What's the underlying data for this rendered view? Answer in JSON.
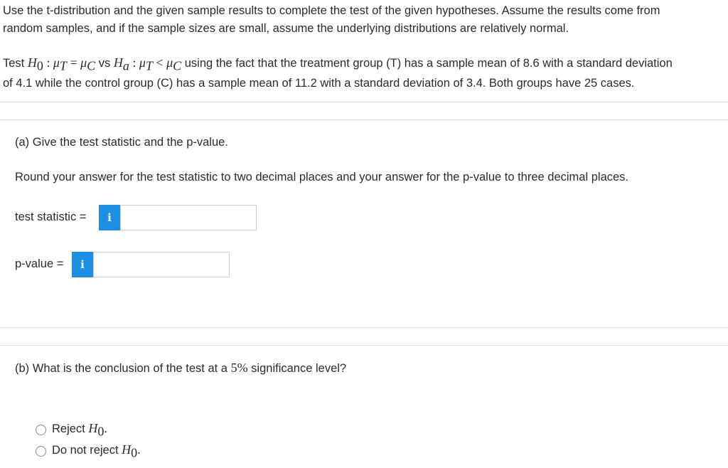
{
  "intro": {
    "line1": "Use the t-distribution and the given sample results to complete the test of the given hypotheses. Assume the results come from",
    "line2": "random samples, and if the sample sizes are small, assume the underlying distributions are relatively normal."
  },
  "problem": {
    "test_word": "Test",
    "vs_word": "vs",
    "text_after": "using the fact that the treatment group (T) has a sample mean of 8.6 with a standard deviation",
    "line2": "of 4.1 while the control group (C) has a sample mean of 11.2 with a standard deviation of 3.4. Both groups have 25 cases."
  },
  "part_a": {
    "title": "(a) Give the test statistic and the p-value.",
    "instructions": "Round your answer for the test statistic to two decimal places and your answer for the p-value to three decimal places.",
    "test_statistic_label": "test statistic =",
    "p_value_label": "p-value =",
    "info_glyph": "i",
    "test_statistic_value": "",
    "p_value_value": ""
  },
  "part_b": {
    "title_before": "(b) What is the conclusion of the test at a",
    "title_percent": "5%",
    "title_after": "significance level?",
    "options": [
      "Reject",
      "Do not reject"
    ]
  },
  "colors": {
    "info_button": "#1a8fe3",
    "divider": "#dcdcdc",
    "text": "#2b2b2b"
  }
}
